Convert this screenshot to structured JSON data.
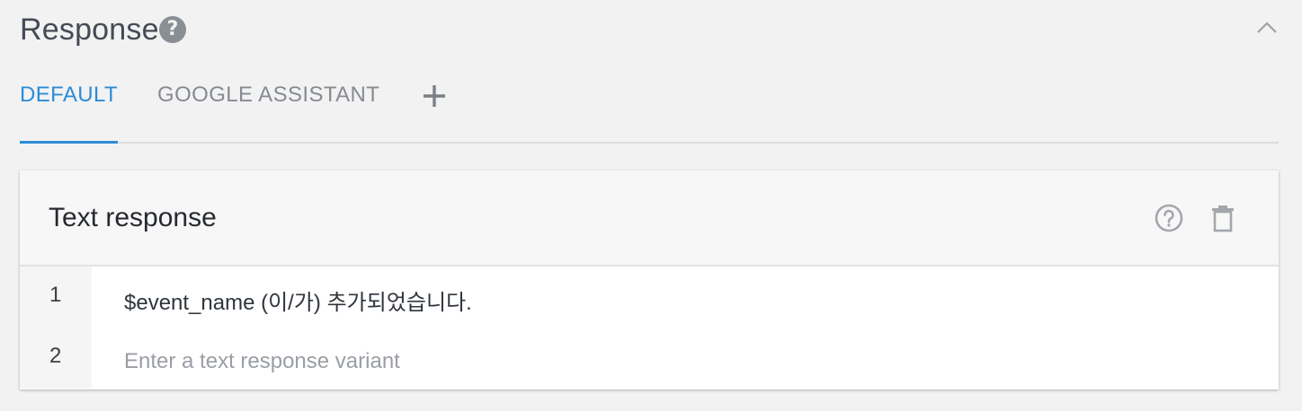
{
  "section": {
    "title": "Response",
    "help_glyph": "?",
    "help_icon": "help-circle-filled-icon",
    "collapse_icon": "chevron-up-icon"
  },
  "tabs": [
    {
      "label": "DEFAULT",
      "active": true
    },
    {
      "label": "GOOGLE ASSISTANT",
      "active": false
    }
  ],
  "add_tab_icon": "plus-icon",
  "card": {
    "title": "Text response",
    "help_icon": "help-circle-outline-icon",
    "delete_icon": "trash-icon",
    "rows": [
      {
        "number": "1",
        "text": "$event_name (이/가)  추가되었습니다."
      },
      {
        "number": "2",
        "placeholder": "Enter a text response variant"
      }
    ]
  },
  "colors": {
    "accent": "#2b8cd6",
    "muted_icon": "#9ea2a8",
    "background": "#f2f2f2"
  }
}
